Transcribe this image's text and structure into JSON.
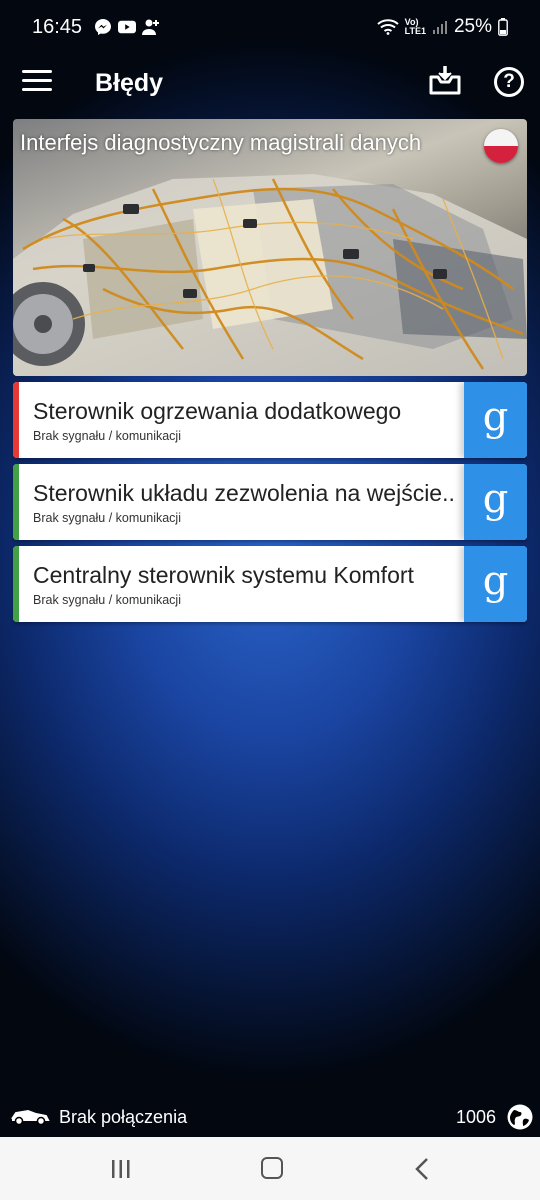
{
  "status_bar": {
    "time": "16:45",
    "battery": "25%",
    "network": "LTE1",
    "volte": "Vo)"
  },
  "app_bar": {
    "title": "Błędy"
  },
  "banner": {
    "title": "Interfejs diagnostyczny magistrali danych",
    "flag": "poland-flag"
  },
  "modules": [
    {
      "name": "Sterownik ogrzewania dodatkowego",
      "status": "Brak sygnału / komunikacji",
      "stripe_color": "#e53935",
      "action": "g"
    },
    {
      "name": "Sterownik układu zezwolenia na wejście..",
      "status": "Brak sygnału / komunikacji",
      "stripe_color": "#43a047",
      "action": "g"
    },
    {
      "name": "Centralny sterownik systemu Komfort",
      "status": "Brak sygnału / komunikacji",
      "stripe_color": "#43a047",
      "action": "g"
    }
  ],
  "footer": {
    "connection": "Brak połączenia",
    "counter": "1006"
  },
  "colors": {
    "accent": "#2f90e8",
    "error": "#e53935",
    "ok": "#43a047"
  }
}
